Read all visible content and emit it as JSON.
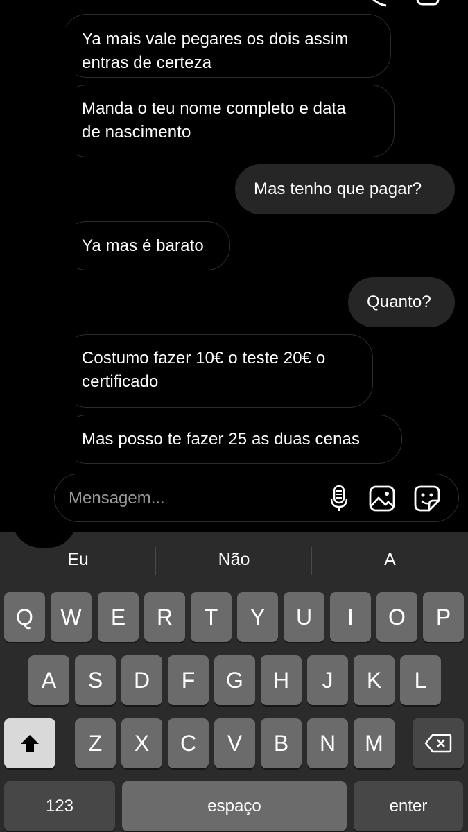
{
  "messages": [
    {
      "side": "in",
      "lines": [
        "Ya mais vale pegares os dois assim",
        "entras de certeza"
      ]
    },
    {
      "side": "in",
      "lines": [
        "Manda o teu nome completo e data",
        "de nascimento"
      ]
    },
    {
      "side": "out",
      "lines": [
        "Mas tenho que pagar?"
      ]
    },
    {
      "side": "in",
      "lines": [
        "Ya mas é barato"
      ]
    },
    {
      "side": "out",
      "lines": [
        "Quanto?"
      ]
    },
    {
      "side": "in",
      "lines": [
        "Costumo fazer 10€ o teste 20€ o",
        "certificado"
      ]
    },
    {
      "side": "in",
      "lines": [
        "Mas posso te fazer 25 as duas cenas"
      ]
    }
  ],
  "composer": {
    "placeholder": "Mensagem...",
    "icons": [
      "microphone-icon",
      "gallery-icon",
      "sticker-icon"
    ]
  },
  "keyboard": {
    "suggestions": [
      "Eu",
      "Não",
      "A"
    ],
    "row1": [
      "Q",
      "W",
      "E",
      "R",
      "T",
      "Y",
      "U",
      "I",
      "O",
      "P"
    ],
    "row2": [
      "A",
      "S",
      "D",
      "F",
      "G",
      "H",
      "J",
      "K",
      "L"
    ],
    "row3": [
      "Z",
      "X",
      "C",
      "V",
      "B",
      "N",
      "M"
    ],
    "numbers_label": "123",
    "space_label": "espaço",
    "enter_label": "enter"
  }
}
